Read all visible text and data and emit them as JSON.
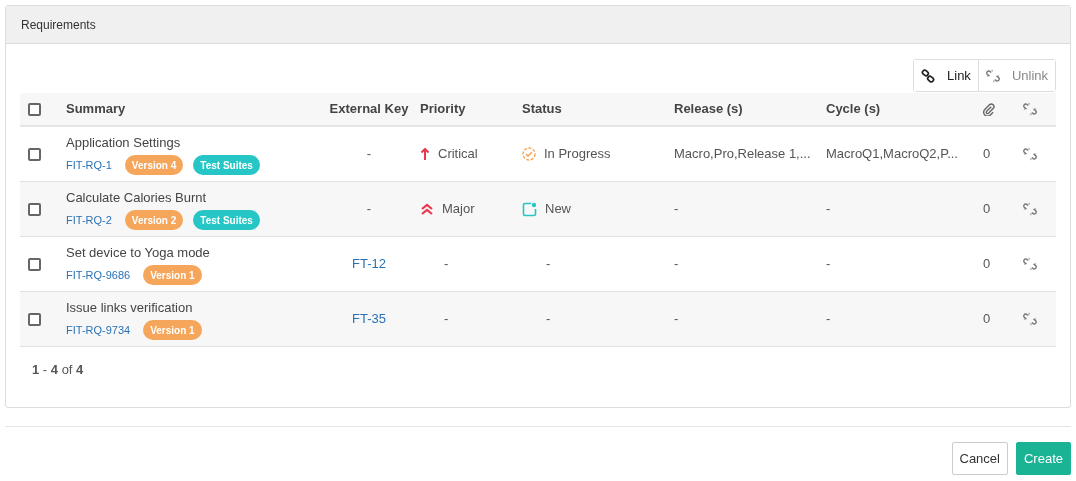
{
  "panel": {
    "title": "Requirements"
  },
  "toggle": [
    {
      "label": "Link",
      "kind": "link",
      "selected": true
    },
    {
      "label": "Unlink",
      "kind": "unlink",
      "selected": false
    }
  ],
  "table": {
    "select_all": {
      "checked": false
    },
    "columns": [
      "Summary",
      "External Key",
      "Priority",
      "Status",
      "Release (s)",
      "Cycle (s)"
    ],
    "rows": [
      {
        "checked": false,
        "summary": "Application Settings",
        "id": "FIT-RQ-1",
        "tags": [
          {
            "label": "Version 4",
            "color": "#f5a65b"
          },
          {
            "label": "Test Suites",
            "color": "#26c6c6"
          }
        ],
        "external_key": "-",
        "external_key_link": false,
        "priority": {
          "kind": "critical",
          "label": "Critical"
        },
        "status": {
          "kind": "in_progress",
          "label": "In Progress"
        },
        "release": "Macro,Pro,Release 1,...",
        "cycle": "MacroQ1,MacroQ2,P...",
        "attachments": "0"
      },
      {
        "checked": false,
        "summary": "Calculate Calories Burnt",
        "id": "FIT-RQ-2",
        "tags": [
          {
            "label": "Version 2",
            "color": "#f5a65b"
          },
          {
            "label": "Test Suites",
            "color": "#26c6c6"
          }
        ],
        "external_key": "-",
        "external_key_link": false,
        "priority": {
          "kind": "major",
          "label": "Major"
        },
        "status": {
          "kind": "new",
          "label": "New"
        },
        "release": "-",
        "cycle": "-",
        "attachments": "0"
      },
      {
        "checked": false,
        "summary": "Set device to Yoga mode",
        "id": "FIT-RQ-9686",
        "tags": [
          {
            "label": "Version 1",
            "color": "#f5a65b"
          }
        ],
        "external_key": "FT-12",
        "external_key_link": true,
        "priority": {
          "kind": "none",
          "label": "-"
        },
        "status": {
          "kind": "none",
          "label": "-"
        },
        "release": "-",
        "cycle": "-",
        "attachments": "0"
      },
      {
        "checked": false,
        "summary": "Issue links verification",
        "id": "FIT-RQ-9734",
        "tags": [
          {
            "label": "Version 1",
            "color": "#f5a65b"
          }
        ],
        "external_key": "FT-35",
        "external_key_link": true,
        "priority": {
          "kind": "none",
          "label": "-"
        },
        "status": {
          "kind": "none",
          "label": "-"
        },
        "release": "-",
        "cycle": "-",
        "attachments": "0"
      }
    ]
  },
  "pagination": "**1** - **4** of **4**",
  "buttons": [
    {
      "label": "Cancel",
      "kind": "secondary"
    },
    {
      "label": "Create",
      "kind": "primary"
    }
  ]
}
